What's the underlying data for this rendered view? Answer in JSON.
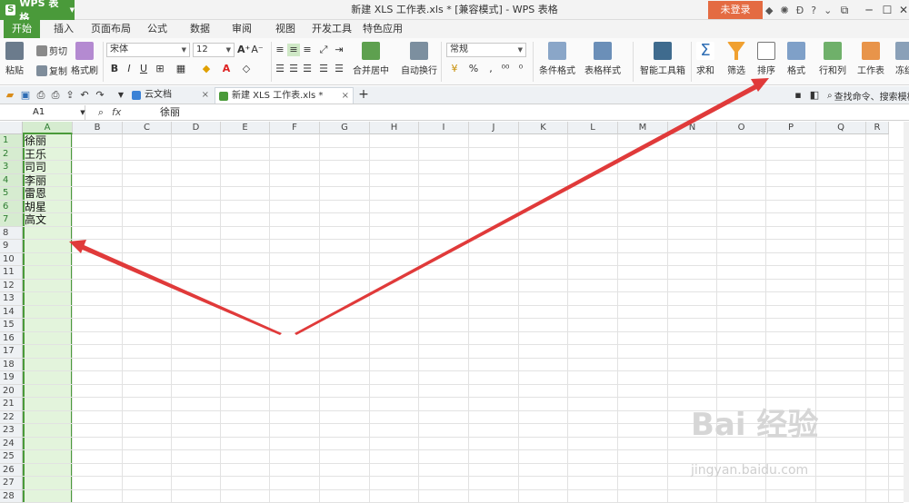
{
  "titlebar": {
    "app_name": "WPS 表格",
    "window_title": "新建 XLS 工作表.xls * [兼容模式] - WPS 表格",
    "login_label": "未登录"
  },
  "ribbon_tabs": [
    "开始",
    "插入",
    "页面布局",
    "公式",
    "数据",
    "审阅",
    "视图",
    "开发工具",
    "特色应用"
  ],
  "ribbon": {
    "paste": "粘贴",
    "cut": "剪切",
    "copy": "复制",
    "format_painter": "格式刷",
    "font_name": "宋体",
    "font_size": "12",
    "merge_center": "合并居中",
    "wrap_text": "自动换行",
    "number_format": "常规",
    "conditional_format": "条件格式",
    "table_style": "表格样式",
    "smart_toolbox": "智能工具箱",
    "sum": "求和",
    "filter": "筛选",
    "sort": "排序",
    "format": "格式",
    "row_col": "行和列",
    "worksheet": "工作表",
    "freeze": "冻结"
  },
  "doc_tabs": [
    {
      "label": "云文档"
    },
    {
      "label": "新建 XLS 工作表.xls *"
    }
  ],
  "doc_tab_extra": "查找命令、搜索模板",
  "formula_bar": {
    "name_box": "A1",
    "fx": "fx",
    "value": "徐丽"
  },
  "columns": [
    "A",
    "B",
    "C",
    "D",
    "E",
    "F",
    "G",
    "H",
    "I",
    "J",
    "K",
    "L",
    "M",
    "N",
    "O",
    "P",
    "Q",
    "R"
  ],
  "rows": [
    "1",
    "2",
    "3",
    "4",
    "5",
    "6",
    "7",
    "8",
    "9",
    "10",
    "11",
    "12",
    "13",
    "14",
    "15",
    "16",
    "17",
    "18",
    "19",
    "20",
    "21",
    "22",
    "23",
    "24",
    "25",
    "26",
    "27",
    "28"
  ],
  "cells_a": [
    "徐丽",
    "王乐",
    "司司",
    "李丽",
    "雷恩",
    "胡星",
    "高文"
  ],
  "watermark": {
    "brand": "Bai 经验",
    "url": "jingyan.baidu.com"
  },
  "colors": {
    "accent": "#4a9a3a",
    "selection": "#e3f4dc",
    "login": "#e46b42",
    "arrow": "#e03a3a"
  }
}
